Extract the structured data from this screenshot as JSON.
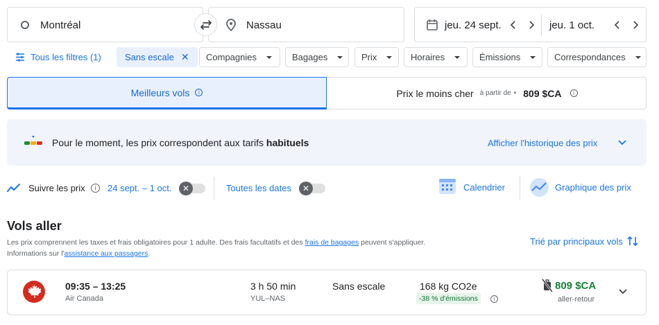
{
  "search": {
    "origin": "Montréal",
    "destination": "Nassau",
    "depart_date": "jeu. 24 sept.",
    "return_date": "jeu. 1 oct."
  },
  "filters": {
    "all_filters": "Tous les filtres (1)",
    "active": "Sans escale",
    "chips": [
      "Compagnies",
      "Bagages",
      "Prix",
      "Horaires",
      "Émissions",
      "Correspondances"
    ]
  },
  "tabs": {
    "best": "Meilleurs vols",
    "cheapest": "Prix le moins cher",
    "from_label": "à partir de",
    "cheapest_price": "809 $CA"
  },
  "insight": {
    "text_prefix": "Pour le moment, les prix correspondent aux tarifs",
    "text_emphasis": "habituels",
    "link": "Afficher l'historique des prix"
  },
  "tracking": {
    "label": "Suivre les prix",
    "dates": "24 sept. – 1 oct.",
    "any_dates": "Toutes les dates",
    "calendar": "Calendrier",
    "price_graph": "Graphique des prix"
  },
  "results": {
    "title": "Vols aller",
    "note_line1_prefix": "Les prix comprennent les taxes et frais obligatoires pour 1 adulte. Des frais facultatifs et des ",
    "note_link1": "frais de bagages",
    "note_line1_suffix": " peuvent s'appliquer.",
    "note_line2_prefix": "Informations sur l'",
    "note_link2": "assistance aux passagers",
    "note_line2_suffix": ".",
    "sort_label": "Trié par principaux vols"
  },
  "flight": {
    "times": "09:35 – 13:25",
    "airline": "Air Canada",
    "duration": "3 h 50 min",
    "route": "YUL–NAS",
    "stops": "Sans escale",
    "emissions": "168 kg CO2e",
    "emissions_delta": "-38 % d'émissions",
    "price": "809 $CA",
    "trip_type": "aller-retour"
  },
  "colors": {
    "accent": "#1a73e8",
    "price_green": "#188038",
    "airline_red": "#d52b1e"
  }
}
